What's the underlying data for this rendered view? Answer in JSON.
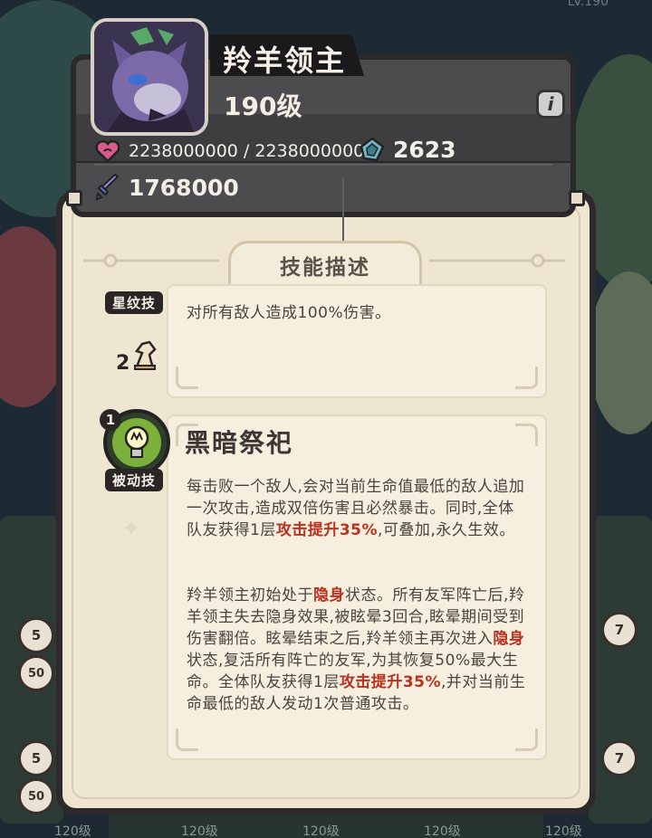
{
  "unit": {
    "name": "羚羊领主",
    "level": "190级",
    "hp": "2238000000 / 2238000000",
    "defense": "2623",
    "attack": "1768000"
  },
  "panel": {
    "tab_title": "技能描述"
  },
  "skills": [
    {
      "label": "星纹技",
      "rank": "2",
      "description": "对所有敌人造成100%伤害。"
    },
    {
      "label": "被动技",
      "badge": "1",
      "name": "黑暗祭祀",
      "p1_a": "每击败一个敌人,会对当前生命值最低的敌人追加一次攻击,造成双倍伤害且必然暴击。同时,全体队友获得1层",
      "p1_h1": "攻击提升35%",
      "p1_b": ",可叠加,永久生效。",
      "p2_a": "羚羊领主初始处于",
      "p2_h1": "隐身",
      "p2_b": "状态。所有友军阵亡后,羚羊领主失去隐身效果,被眩晕3回合,眩晕期间受到伤害翻倍。眩晕结束之后,羚羊领主再次进入",
      "p2_h2": "隐身",
      "p2_c": "状态,复活所有阵亡的友军,为其恢复50%最大生命。全体队友获得1层",
      "p2_h3": "攻击提升35%",
      "p2_d": ",并对当前生命最低的敌人发动1次普通攻击。"
    }
  ],
  "background": {
    "top_level": "LV.190",
    "side_badges_left": [
      "5",
      "50",
      "5",
      "50"
    ],
    "side_badges_right": [
      "7",
      "7"
    ],
    "bottom_levels": [
      "120级",
      "120级",
      "120级",
      "120级",
      "120级"
    ]
  },
  "icons": {
    "portrait": "antelope-lord-portrait",
    "hp": "heart-icon",
    "defense": "shield-icon",
    "attack": "sword-icon",
    "info": "info-icon",
    "rank": "chess-knight-icon",
    "passive": "lightbulb-icon"
  },
  "colors": {
    "highlight": "#b8321e",
    "panel_bg": "#efe6d1",
    "header_bg": "#4c4c4e",
    "passive_orb": "#7bb13b"
  }
}
